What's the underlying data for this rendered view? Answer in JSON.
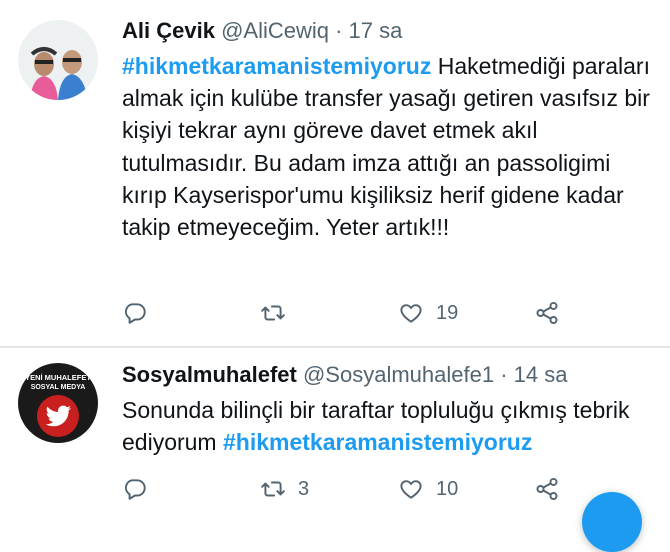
{
  "tweets": [
    {
      "name": "Ali Çevik",
      "handle": "@AliCewiq",
      "sep": " · ",
      "time": "17 sa",
      "hashtag": "#hikmetkaramanistemiyoruz",
      "text": " Haketmediği paraları almak için kulübe transfer yasağı getiren vasıfsız bir kişiyi tekrar aynı göreve davet etmek akıl tutulmasıdır. Bu adam imza attığı an passoligimi kırıp Kayserispor'umu kişiliksiz herif gidene kadar takip etmeyeceğim. Yeter artık!!!",
      "replies": "",
      "retweets": "",
      "likes": "19"
    },
    {
      "name": "Sosyalmuhalefet",
      "handle": "@Sosyalmuhalefe1",
      "sep": " · ",
      "time": "14 sa",
      "text": "Sonunda bilinçli bir taraftar topluluğu çıkmış tebrik ediyorum ",
      "hashtag": "#hikmetkaramanistemiyoruz",
      "avatar_text_line1": "YENİ MUHALEFET",
      "avatar_text_line2": "SOSYAL MEDYA",
      "replies": "",
      "retweets": "3",
      "likes": "10"
    }
  ],
  "icons": [
    "reply-icon",
    "retweet-icon",
    "like-icon",
    "share-icon",
    "twitter-bird-icon"
  ],
  "colors": {
    "accent": "#1d9bf0",
    "muted": "#536471",
    "text": "#0f1419",
    "avatar_red": "#c8201e"
  }
}
